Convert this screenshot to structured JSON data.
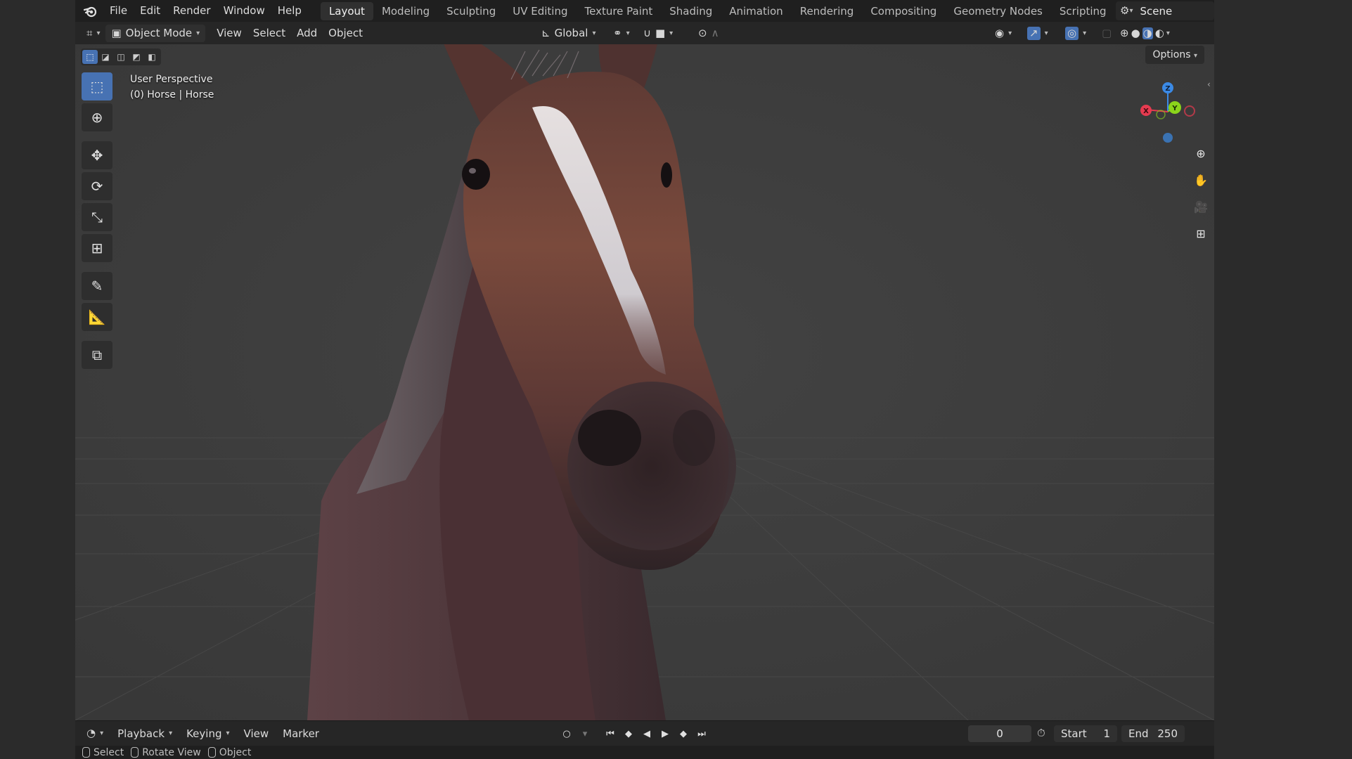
{
  "topbar": {
    "menus": [
      "File",
      "Edit",
      "Render",
      "Window",
      "Help"
    ],
    "workspaces": [
      "Layout",
      "Modeling",
      "Sculpting",
      "UV Editing",
      "Texture Paint",
      "Shading",
      "Animation",
      "Rendering",
      "Compositing",
      "Geometry Nodes",
      "Scripting"
    ],
    "active_workspace": "Layout",
    "scene_name": "Scene"
  },
  "header": {
    "mode": "Object Mode",
    "menus": [
      "View",
      "Select",
      "Add",
      "Object"
    ],
    "orientation": "Global"
  },
  "viewport": {
    "perspective_label": "User Perspective",
    "object_label": "(0) Horse | Horse",
    "options_label": "Options",
    "gizmo": {
      "x": "X",
      "y": "Y",
      "z": "Z"
    },
    "colors": {
      "background": "#3d3d3d",
      "x_axis": "#e63b50",
      "y_axis": "#8bd41b",
      "z_axis": "#3b8ae6",
      "accent": "#4772b3"
    }
  },
  "timeline": {
    "menus": [
      "Playback",
      "Keying",
      "View",
      "Marker"
    ],
    "current_frame": "0",
    "start_label": "Start",
    "start_value": "1",
    "end_label": "End",
    "end_value": "250"
  },
  "statusbar": {
    "items": [
      "Select",
      "Rotate View",
      "Object"
    ]
  }
}
